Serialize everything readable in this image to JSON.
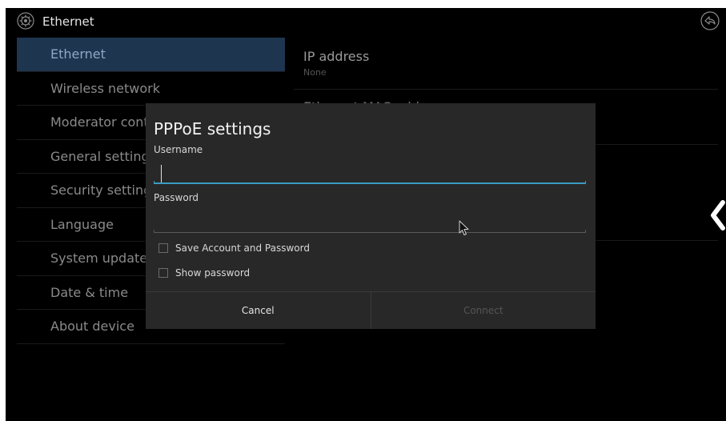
{
  "app": {
    "title": "Ethernet",
    "icon": "gear-icon",
    "back_icon": "back-icon"
  },
  "menu": {
    "items": [
      {
        "label": "Ethernet",
        "active": true
      },
      {
        "label": "Wireless network"
      },
      {
        "label": "Moderator control"
      },
      {
        "label": "General settings"
      },
      {
        "label": "Security settings"
      },
      {
        "label": "Language"
      },
      {
        "label": "System update"
      },
      {
        "label": "Date & time"
      },
      {
        "label": "About device"
      }
    ]
  },
  "panel": {
    "ip_title": "IP address",
    "ip_value": "None",
    "mac_title": "Ethernet MAC address"
  },
  "dialog": {
    "title": "PPPoE settings",
    "username_label": "Username",
    "username_value": "",
    "password_label": "Password",
    "password_value": "",
    "save_account_label": "Save Account and Password",
    "show_password_label": "Show password",
    "cancel_label": "Cancel",
    "connect_label": "Connect"
  },
  "colors": {
    "accent": "#3a9bc4",
    "active_row": "#1e3550"
  }
}
